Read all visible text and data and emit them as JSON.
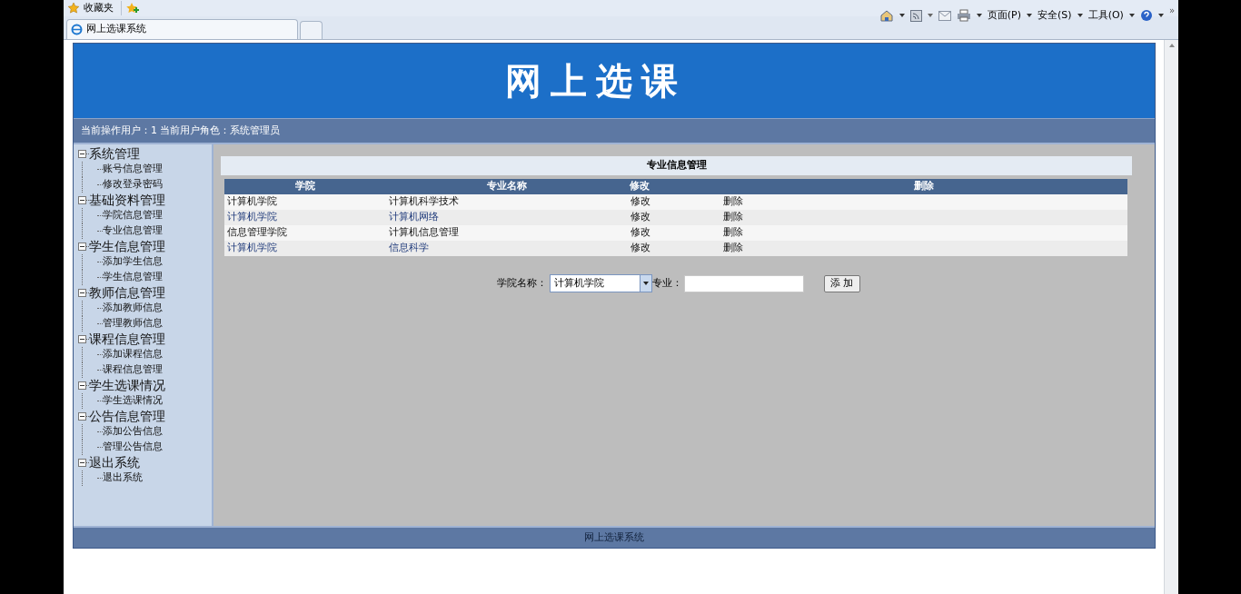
{
  "browser": {
    "favorites": "收藏夹",
    "tab_title": "网上选课系统",
    "menus": [
      "页面(P)",
      "安全(S)",
      "工具(O)"
    ],
    "more": "»"
  },
  "banner": {
    "title": "网上选课"
  },
  "info_bar": "当前操作用户：1 当前用户角色：系统管理员",
  "sidebar": [
    {
      "label": "系统管理",
      "expanded": true,
      "children": [
        {
          "label": "账号信息管理"
        },
        {
          "label": "修改登录密码"
        }
      ]
    },
    {
      "label": "基础资料管理",
      "expanded": true,
      "children": [
        {
          "label": "学院信息管理"
        },
        {
          "label": "专业信息管理"
        }
      ]
    },
    {
      "label": "学生信息管理",
      "expanded": true,
      "children": [
        {
          "label": "添加学生信息"
        },
        {
          "label": "学生信息管理"
        }
      ]
    },
    {
      "label": "教师信息管理",
      "expanded": true,
      "children": [
        {
          "label": "添加教师信息"
        },
        {
          "label": "管理教师信息"
        }
      ]
    },
    {
      "label": "课程信息管理",
      "expanded": true,
      "children": [
        {
          "label": "添加课程信息"
        },
        {
          "label": "课程信息管理"
        }
      ]
    },
    {
      "label": "学生选课情况",
      "expanded": true,
      "children": [
        {
          "label": "学生选课情况"
        }
      ]
    },
    {
      "label": "公告信息管理",
      "expanded": true,
      "children": [
        {
          "label": "添加公告信息"
        },
        {
          "label": "管理公告信息"
        }
      ]
    },
    {
      "label": "退出系统",
      "expanded": true,
      "children": [
        {
          "label": "退出系统"
        }
      ]
    }
  ],
  "panel_title": "专业信息管理",
  "table": {
    "columns": [
      "学院",
      "专业名称",
      "修改",
      "删除"
    ],
    "rows": [
      {
        "cells": [
          "计算机学院",
          "计算机科学技术",
          "修改",
          "删除"
        ],
        "visited": false
      },
      {
        "cells": [
          "计算机学院",
          "计算机网络",
          "修改",
          "删除"
        ],
        "visited": true
      },
      {
        "cells": [
          "信息管理学院",
          "计算机信息管理",
          "修改",
          "删除"
        ],
        "visited": false
      },
      {
        "cells": [
          "计算机学院",
          "信息科学",
          "修改",
          "删除"
        ],
        "visited": true
      }
    ]
  },
  "form": {
    "college_label": "学院名称：",
    "college_value": "计算机学院",
    "major_label": "专业：",
    "add_button": "添 加"
  },
  "footer": "网上选课系统"
}
